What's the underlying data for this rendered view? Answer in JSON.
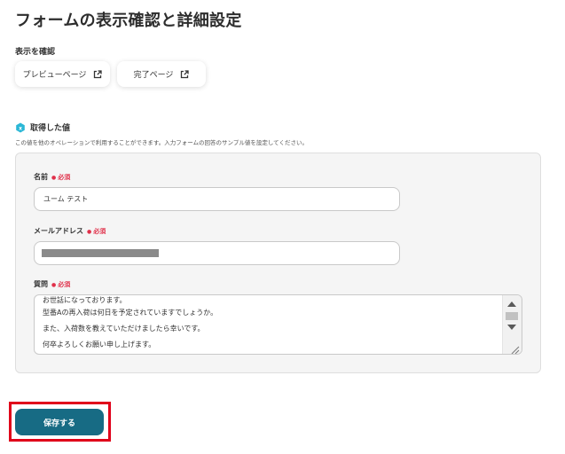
{
  "page": {
    "title": "フォームの表示確認と詳細設定"
  },
  "display_check": {
    "label": "表示を確認",
    "preview_button": "プレビューページ",
    "complete_button": "完了ページ"
  },
  "acquired_values": {
    "heading": "取得した値",
    "description": "この値を他のオペレーションで利用することができます。入力フォームの回答のサンプル値を設定してください。"
  },
  "form": {
    "name_field": {
      "label": "名前",
      "required": "必須",
      "value": "ユーム テスト"
    },
    "email_field": {
      "label": "メールアドレス",
      "required": "必須",
      "value_masked": true
    },
    "question_field": {
      "label": "質問",
      "required": "必須",
      "lines": [
        "お世話になっております。",
        "型番Aの再入荷は何日を予定されていますでしょうか。",
        "また、入荷数を教えていただけましたら幸いです。",
        "何卒よろしくお願い申し上げます。"
      ]
    }
  },
  "actions": {
    "save_button": "保存する",
    "highlight_color": "#e0001a",
    "primary_color": "#176b84"
  },
  "icons": {
    "external_link": "external-link-icon",
    "badge": "hexagon-badge-icon"
  }
}
